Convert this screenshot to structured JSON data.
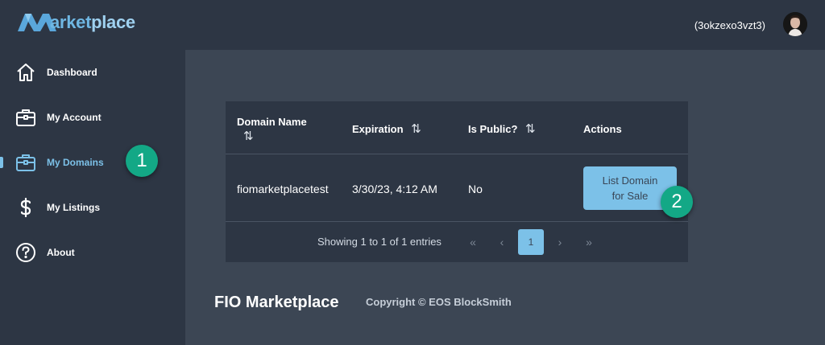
{
  "header": {
    "logo_prefix": "arket",
    "logo_suffix": "place",
    "user_name": "(3okzexo3vzt3)"
  },
  "sidebar": {
    "items": [
      {
        "label": "Dashboard",
        "icon": "home-icon"
      },
      {
        "label": "My Account",
        "icon": "briefcase-icon"
      },
      {
        "label": "My Domains",
        "icon": "briefcase-icon",
        "active": true
      },
      {
        "label": "My Listings",
        "icon": "dollar-icon"
      },
      {
        "label": "About",
        "icon": "question-circle-icon"
      }
    ]
  },
  "badges": {
    "step1": "1",
    "step2": "2"
  },
  "table": {
    "headers": {
      "domain_name": "Domain Name",
      "expiration": "Expiration",
      "is_public": "Is Public?",
      "actions": "Actions"
    },
    "sort_symbol": "⇅",
    "rows": [
      {
        "domain_name": "fiomarketplacetest",
        "expiration": "3/30/23, 4:12 AM",
        "is_public": "No",
        "action_line1": "List Domain",
        "action_line2": "for Sale"
      }
    ],
    "pagination": {
      "info": "Showing 1 to 1 of 1 entries",
      "first": "«",
      "prev": "‹",
      "current": "1",
      "next": "›",
      "last": "»"
    }
  },
  "footer": {
    "title": "FIO Marketplace",
    "copyright": "Copyright © EOS BlockSmith"
  },
  "colors": {
    "background": "#3c4654",
    "panel": "#2d3644",
    "accent": "#7cc1e8",
    "badge": "#13a886"
  }
}
